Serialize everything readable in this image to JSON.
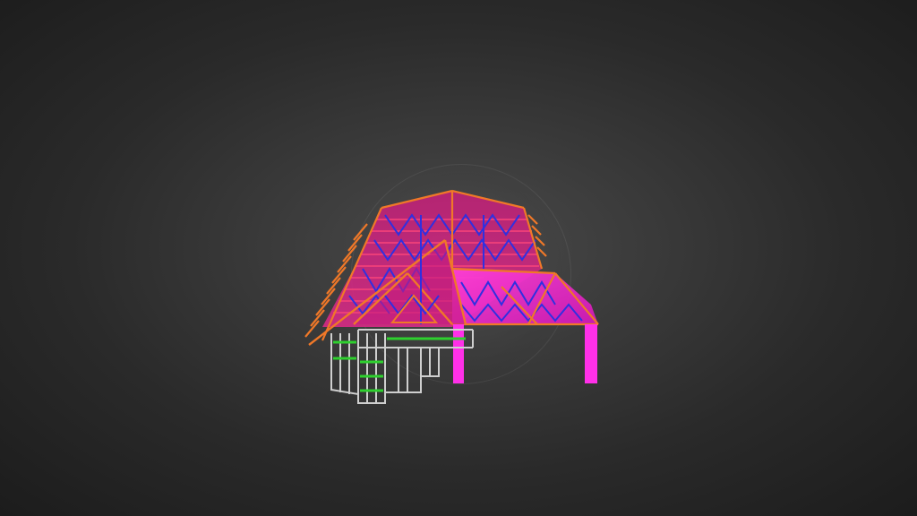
{
  "viewer": {
    "background": "#2f2f2f",
    "model": {
      "icon": "3d-model-icon",
      "colors": {
        "roof_surface": "#e0207f",
        "rafter": "#f07a2a",
        "truss_web": "#3a3ad8",
        "batten": "#e03030",
        "wall_frame": "#c8c8c8",
        "noggin": "#2ed02e",
        "post": "#ff30ff"
      }
    }
  }
}
